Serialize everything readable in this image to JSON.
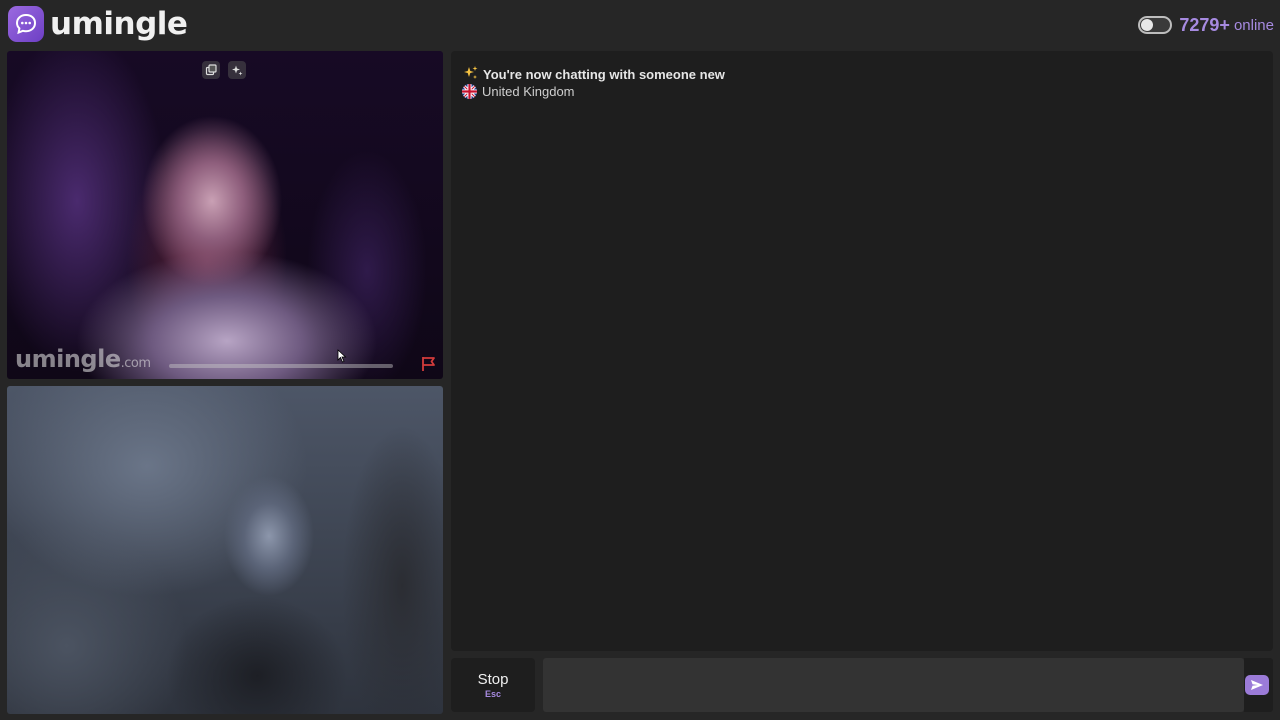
{
  "header": {
    "brand": "umingle",
    "online_count": "7279+",
    "online_label": "online",
    "dark_mode_toggle": "off"
  },
  "stranger_video": {
    "watermark": "umingle",
    "watermark_suffix": ".com",
    "icons": [
      "pip-icon",
      "sparkle-effects-icon",
      "report-flag-icon"
    ]
  },
  "self_video": {},
  "chat": {
    "messages": [
      {
        "icon": "sparkles-icon",
        "text": "You're now chatting with someone new"
      },
      {
        "icon": "uk-flag-icon",
        "text": "United Kingdom"
      }
    ]
  },
  "controls": {
    "stop_label": "Stop",
    "stop_shortcut": "Esc",
    "message_value": "",
    "send_icon": "send-icon"
  },
  "colors": {
    "accent": "#a68ae0",
    "brand_purple": "#7e4fd1",
    "report_red": "#d23b3b",
    "panel_bg": "#1e1e1e",
    "page_bg": "#262626"
  }
}
